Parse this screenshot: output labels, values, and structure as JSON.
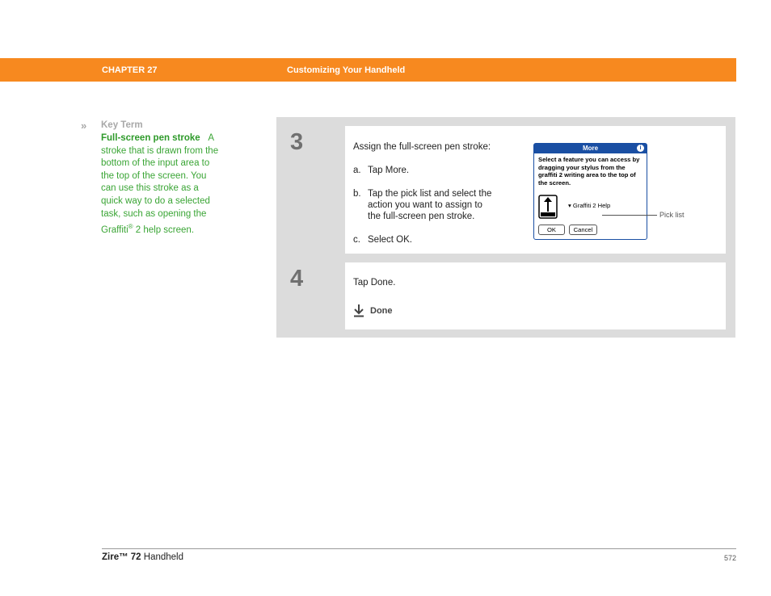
{
  "header": {
    "chapter": "CHAPTER 27",
    "title": "Customizing Your Handheld",
    "bg_color": "#f7891f"
  },
  "sidebar": {
    "chevron": "»",
    "heading": "Key Term",
    "term": "Full-screen pen stroke",
    "definition_1": "A stroke that is drawn from the bottom of the input area to the top of the screen. You can use this stroke as a quick way to do a selected task, such as opening the Graffiti",
    "reg": "®",
    "definition_2": " 2 help screen."
  },
  "steps": [
    {
      "number": "3",
      "intro": "Assign the full-screen pen stroke:",
      "a_marker": "a.",
      "a_text": "Tap More.",
      "b_marker": "b.",
      "b_text_1": "Tap the pick list and select the",
      "b_text_2": "action you want to assign to",
      "b_text_3": "the full-screen pen stroke.",
      "c_marker": "c.",
      "c_text": "Select OK."
    },
    {
      "number": "4",
      "text": "Tap Done.",
      "done_label": "Done"
    }
  ],
  "palm_screen": {
    "title": "More",
    "info": "i",
    "message": "Select a feature you can access by dragging your stylus from the graffiti 2 writing area to the top of the screen.",
    "pick_value": "Graffiti 2 Help",
    "ok": "OK",
    "cancel": "Cancel",
    "accent": "#1a4fa3"
  },
  "callout": "Pick list",
  "footer": {
    "product": "Zire™ 72",
    "product_suffix": " Handheld",
    "page": "572"
  }
}
